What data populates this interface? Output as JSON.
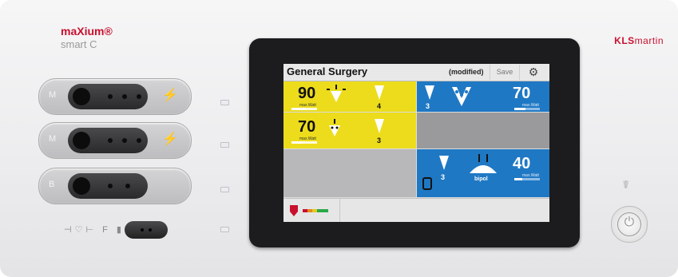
{
  "device": {
    "brand_name": "maXium®",
    "brand_sub": "smart C",
    "manufacturer_a": "KLS",
    "manufacturer_b": "martin",
    "sockets": [
      {
        "label": "M"
      },
      {
        "label": "M"
      },
      {
        "label": "B"
      }
    ],
    "symbols_row": "⊣♡⊢ F ▮▮"
  },
  "screen": {
    "title": "General Surgery",
    "status": "(modified)",
    "save_label": "Save",
    "settings_icon": "gear-icon",
    "unit_label": "max.Watt",
    "panels": {
      "row1_left": {
        "value": "90",
        "count": "4",
        "bar_level": 0.55
      },
      "row1_right": {
        "value": "70",
        "count": "3",
        "bar_level": 0.45
      },
      "row2_left": {
        "value": "70",
        "count": "3",
        "bar_level": 0.45
      },
      "row3_right": {
        "value": "40",
        "count": "3",
        "mode": "bipol",
        "bar_level": 0.3
      }
    },
    "colors": {
      "monopolar": "#ecdc1c",
      "bipolar": "#1f78c4",
      "inactive": "#b8b8ba"
    }
  }
}
